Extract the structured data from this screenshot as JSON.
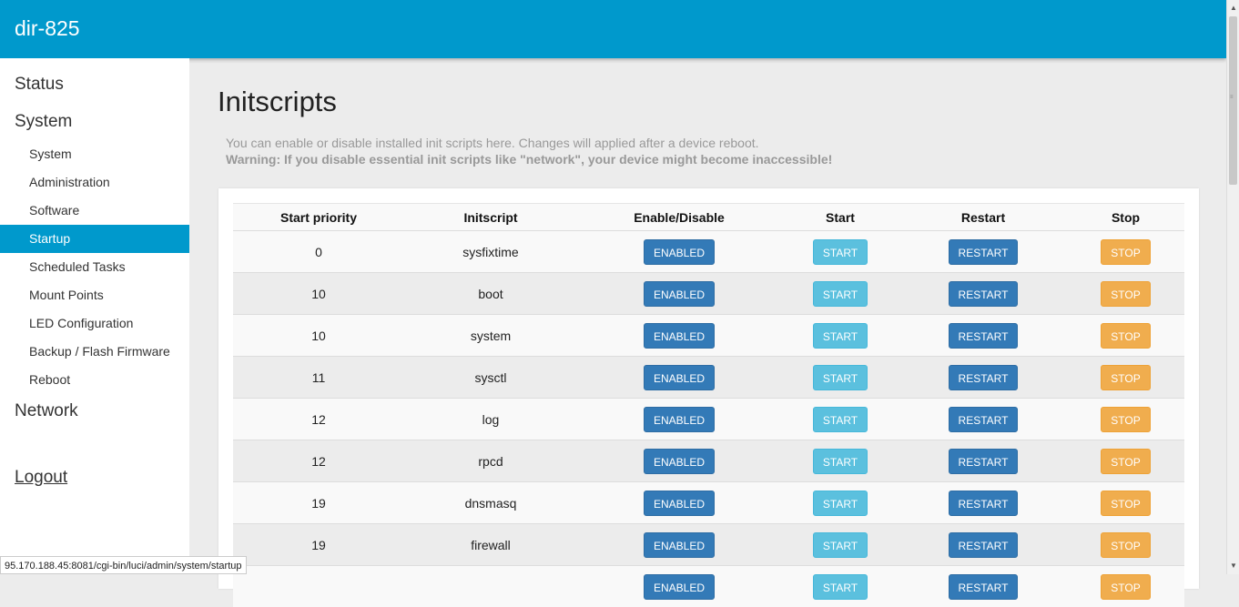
{
  "header": {
    "brand": "dir-825"
  },
  "sidebar": {
    "status": "Status",
    "system": "System",
    "items": [
      {
        "label": "System",
        "active": false
      },
      {
        "label": "Administration",
        "active": false
      },
      {
        "label": "Software",
        "active": false
      },
      {
        "label": "Startup",
        "active": true
      },
      {
        "label": "Scheduled Tasks",
        "active": false
      },
      {
        "label": "Mount Points",
        "active": false
      },
      {
        "label": "LED Configuration",
        "active": false
      },
      {
        "label": "Backup / Flash Firmware",
        "active": false
      },
      {
        "label": "Reboot",
        "active": false
      }
    ],
    "network": "Network",
    "logout": "Logout"
  },
  "main": {
    "title": "Initscripts",
    "description": "You can enable or disable installed init scripts here. Changes will applied after a device reboot.",
    "warning": "Warning: If you disable essential init scripts like \"network\", your device might become inaccessible!",
    "table": {
      "headers": [
        "Start priority",
        "Initscript",
        "Enable/Disable",
        "Start",
        "Restart",
        "Stop"
      ],
      "rows": [
        {
          "priority": "0",
          "name": "sysfixtime",
          "enable": "ENABLED",
          "start": "START",
          "restart": "RESTART",
          "stop": "STOP"
        },
        {
          "priority": "10",
          "name": "boot",
          "enable": "ENABLED",
          "start": "START",
          "restart": "RESTART",
          "stop": "STOP"
        },
        {
          "priority": "10",
          "name": "system",
          "enable": "ENABLED",
          "start": "START",
          "restart": "RESTART",
          "stop": "STOP"
        },
        {
          "priority": "11",
          "name": "sysctl",
          "enable": "ENABLED",
          "start": "START",
          "restart": "RESTART",
          "stop": "STOP"
        },
        {
          "priority": "12",
          "name": "log",
          "enable": "ENABLED",
          "start": "START",
          "restart": "RESTART",
          "stop": "STOP"
        },
        {
          "priority": "12",
          "name": "rpcd",
          "enable": "ENABLED",
          "start": "START",
          "restart": "RESTART",
          "stop": "STOP"
        },
        {
          "priority": "19",
          "name": "dnsmasq",
          "enable": "ENABLED",
          "start": "START",
          "restart": "RESTART",
          "stop": "STOP"
        },
        {
          "priority": "19",
          "name": "firewall",
          "enable": "ENABLED",
          "start": "START",
          "restart": "RESTART",
          "stop": "STOP"
        },
        {
          "priority": "",
          "name": "",
          "enable": "ENABLED",
          "start": "START",
          "restart": "RESTART",
          "stop": "STOP"
        }
      ]
    }
  },
  "statusbar": {
    "url": "95.170.188.45:8081/cgi-bin/luci/admin/system/startup"
  },
  "colors": {
    "header": "#0099cc",
    "active_nav": "#0099cc",
    "enabled_button": "#337ab7",
    "start_button": "#5bc0de",
    "restart_button": "#337ab7",
    "stop_button": "#f0ad4e"
  }
}
